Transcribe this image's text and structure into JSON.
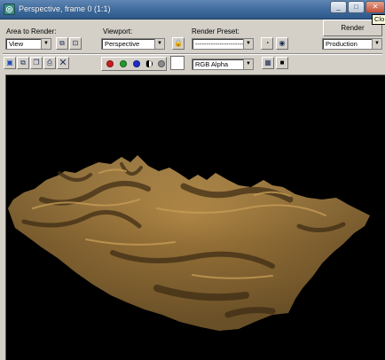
{
  "window": {
    "title": "Perspective, frame 0 (1:1)",
    "icon": "3dsmax-app-icon",
    "tooltip": "Clo"
  },
  "area_to_render": {
    "label": "Area to Render:",
    "value": "View"
  },
  "viewport_select": {
    "label": "Viewport:",
    "value": "Perspective"
  },
  "render_preset": {
    "label": "Render Preset:",
    "value": "------------------------"
  },
  "render_button": {
    "label": "Render"
  },
  "production_select": {
    "value": "Production"
  },
  "channels": {
    "colors": {
      "red": "#c81e1e",
      "green": "#1f9a2a",
      "blue": "#1f2fc4",
      "alpha": "#8a8a8a"
    },
    "display_value": "RGB Alpha"
  },
  "terrain": {
    "color": "#a27a3c",
    "highlight": "#c59b55",
    "shadow": "#3b2a12"
  }
}
